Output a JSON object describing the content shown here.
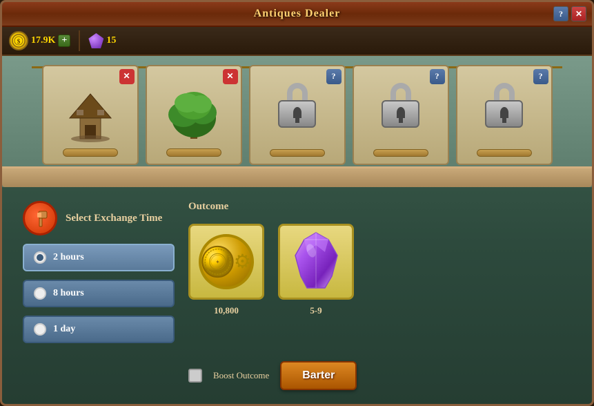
{
  "window": {
    "title": "Antiques Dealer",
    "help_btn": "?",
    "close_btn": "✕"
  },
  "currency": {
    "coins": "17.9K",
    "gems": "15",
    "add_label": "+"
  },
  "shelf": {
    "items": [
      {
        "type": "building",
        "badge": "X",
        "badge_type": "x"
      },
      {
        "type": "tree",
        "badge": "X",
        "badge_type": "x"
      },
      {
        "type": "locked",
        "badge": "?",
        "badge_type": "q"
      },
      {
        "type": "locked",
        "badge": "?",
        "badge_type": "q"
      },
      {
        "type": "locked",
        "badge": "?",
        "badge_type": "q"
      }
    ]
  },
  "exchange": {
    "section_label": "Select Exchange Time",
    "hammer_icon": "🔨",
    "options": [
      {
        "id": "2h",
        "label": "2 hours",
        "selected": true
      },
      {
        "id": "8h",
        "label": "8 hours",
        "selected": false
      },
      {
        "id": "1d",
        "label": "1 day",
        "selected": false
      }
    ]
  },
  "outcome": {
    "section_label": "Outcome",
    "items": [
      {
        "type": "coin",
        "value": "10,800"
      },
      {
        "type": "crystal",
        "value": "5-9"
      }
    ]
  },
  "actions": {
    "boost_label": "Boost Outcome",
    "barter_label": "Barter"
  }
}
